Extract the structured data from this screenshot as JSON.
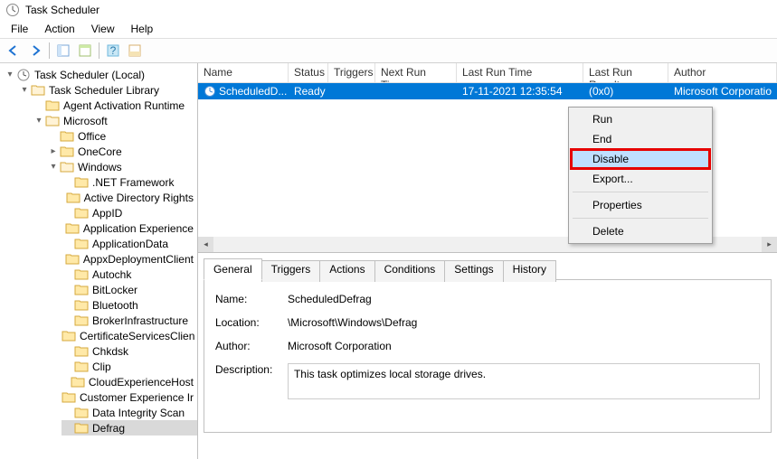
{
  "title": "Task Scheduler",
  "menu": {
    "file": "File",
    "action": "Action",
    "view": "View",
    "help": "Help"
  },
  "tree": {
    "root": "Task Scheduler (Local)",
    "library": "Task Scheduler Library",
    "agent": "Agent Activation Runtime",
    "microsoft": "Microsoft",
    "office": "Office",
    "onecore": "OneCore",
    "windows": "Windows",
    "items": [
      ".NET Framework",
      "Active Directory Rights",
      "AppID",
      "Application Experience",
      "ApplicationData",
      "AppxDeploymentClient",
      "Autochk",
      "BitLocker",
      "Bluetooth",
      "BrokerInfrastructure",
      "CertificateServicesClien",
      "Chkdsk",
      "Clip",
      "CloudExperienceHost",
      "Customer Experience Ir",
      "Data Integrity Scan",
      "Defrag"
    ]
  },
  "columns": {
    "name": "Name",
    "status": "Status",
    "triggers": "Triggers",
    "next": "Next Run Time",
    "last": "Last Run Time",
    "result": "Last Run Result",
    "author": "Author"
  },
  "row": {
    "name": "ScheduledD...",
    "status": "Ready",
    "triggers": "",
    "next": "",
    "last": "17-11-2021 12:35:54",
    "result": "(0x0)",
    "author": "Microsoft Corporatio"
  },
  "ctx": {
    "run": "Run",
    "end": "End",
    "disable": "Disable",
    "export": "Export...",
    "properties": "Properties",
    "delete": "Delete"
  },
  "detail_tabs": {
    "general": "General",
    "triggers": "Triggers",
    "actions": "Actions",
    "conditions": "Conditions",
    "settings": "Settings",
    "history": "History"
  },
  "details": {
    "name_label": "Name:",
    "name_value": "ScheduledDefrag",
    "location_label": "Location:",
    "location_value": "\\Microsoft\\Windows\\Defrag",
    "author_label": "Author:",
    "author_value": "Microsoft Corporation",
    "description_label": "Description:",
    "description_value": "This task optimizes local storage drives."
  }
}
